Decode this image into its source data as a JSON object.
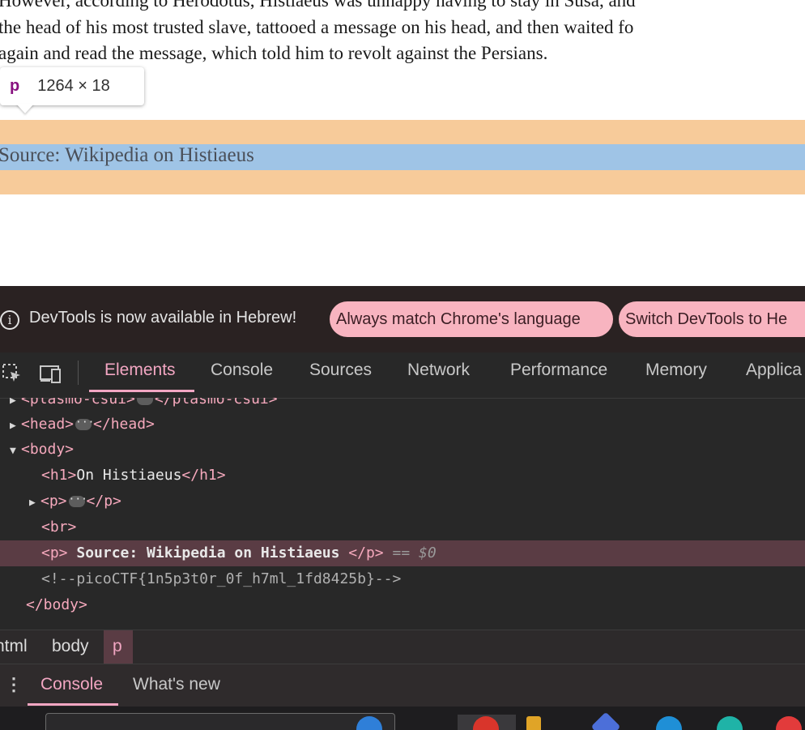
{
  "page": {
    "paragraph_lines": [
      "However, according to Herodotus, Histiaeus was unhappy having to stay in Susa, and",
      "the head of his most trusted slave, tattooed a message on his head, and then waited fo",
      "again and read the message, which told him to revolt against the Persians."
    ],
    "source_text": "Source: Wikipedia on Histiaeus",
    "tooltip": {
      "tag": "p",
      "dimensions": "1264 × 18"
    },
    "colors": {
      "margin_highlight": "#f7cb9a",
      "content_highlight": "#9fc4e6"
    }
  },
  "devtools": {
    "infobar": {
      "icon": "info-icon",
      "message": "DevTools is now available in Hebrew!",
      "button_match": "Always match Chrome's language",
      "button_switch": "Switch DevTools to He"
    },
    "toolbar": {
      "icons": [
        "inspect-element-icon",
        "device-toolbar-icon"
      ],
      "tabs": [
        "Elements",
        "Console",
        "Sources",
        "Network",
        "Performance",
        "Memory",
        "Applica"
      ],
      "active_tab": "Elements"
    },
    "dom": {
      "plasmo_open": "<plasmo-csui>",
      "plasmo_close": "</plasmo-csui>",
      "head_open": "<head>",
      "head_close": "</head>",
      "body_open": "<body>",
      "h1_open": "<h1>",
      "h1_text": "On Histiaeus",
      "h1_close": "</h1>",
      "p_open": "<p>",
      "p_close": "</p>",
      "br": "<br>",
      "sel_open": "<p>",
      "sel_text": " Source: Wikipedia on Histiaeus ",
      "sel_close": "</p>",
      "sel_marker": " == $0",
      "comment": "<!--picoCTF{1n5p3t0r_0f_h7ml_1fd8425b}-->",
      "body_close": "</body>"
    },
    "breadcrumbs": [
      "html",
      "body",
      "p"
    ],
    "drawer": {
      "tabs": [
        "Console",
        "What's new"
      ],
      "active": "Console"
    },
    "accent_color": "#f2a6c2"
  }
}
